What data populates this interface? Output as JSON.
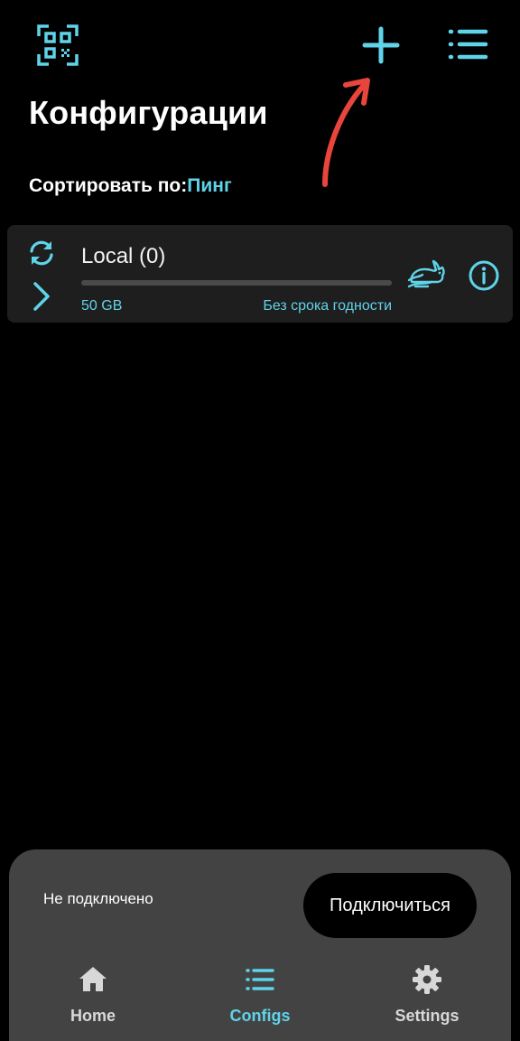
{
  "header": {
    "title": "Конфигурации",
    "icons": {
      "qr": "qr-code-icon",
      "add": "plus-icon",
      "menu": "list-icon"
    }
  },
  "sort": {
    "label": "Сортировать по:",
    "value": "Пинг"
  },
  "configs": [
    {
      "name": "Local (0)",
      "usage": "50 GB",
      "expiry": "Без срока годности",
      "progress": 0
    }
  ],
  "bottom": {
    "status": "Не подключено",
    "connect_label": "Подключиться"
  },
  "nav": {
    "items": [
      {
        "label": "Home",
        "icon": "home-icon"
      },
      {
        "label": "Configs",
        "icon": "list-icon"
      },
      {
        "label": "Settings",
        "icon": "gear-icon"
      }
    ],
    "active": "Configs"
  },
  "colors": {
    "accent": "#5fd3e8",
    "background": "#000000",
    "card": "#1e1e1f",
    "sheet": "#434344",
    "annotation": "#e8453c"
  }
}
